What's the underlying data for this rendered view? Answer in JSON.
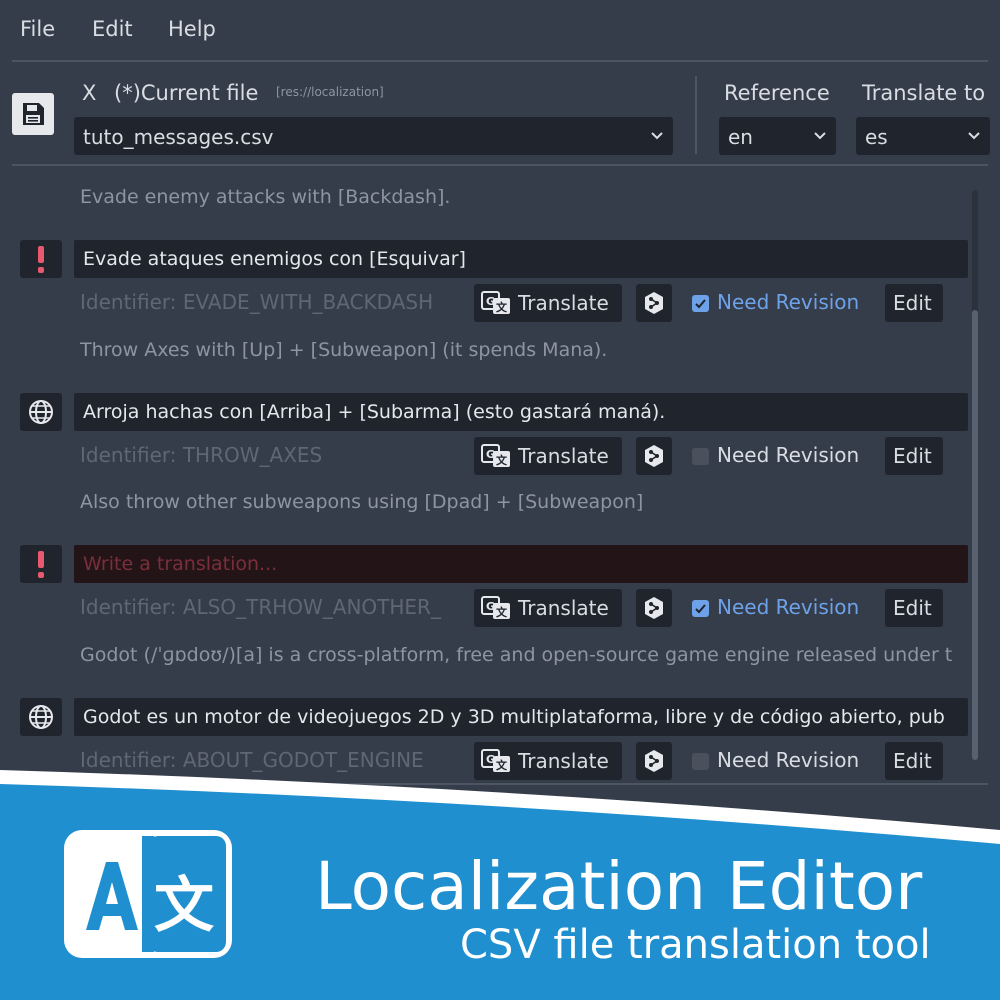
{
  "menu": {
    "file": "File",
    "edit": "Edit",
    "help": "Help"
  },
  "header": {
    "close_label": "X",
    "current_file_label": "(*)Current file",
    "path": "[res://localization]",
    "file_select": "tuto_messages.csv",
    "reference_label": "Reference",
    "reference_value": "en",
    "translate_to_label": "Translate to",
    "translate_to_value": "es"
  },
  "entries": [
    {
      "reference": "Evade enemy attacks with [Backdash].",
      "translation": "Evade ataques enemigos con [Esquivar]",
      "placeholder": "",
      "status": "warning",
      "identifier": "Identifier: EVADE_WITH_BACKDASH",
      "translate_label": "Translate",
      "need_revision_label": "Need Revision",
      "need_revision": true,
      "edit_label": "Edit"
    },
    {
      "reference": "Throw Axes with [Up] + [Subweapon] (it spends Mana).",
      "translation": "Arroja hachas con [Arriba] + [Subarma] (esto gastará maná).",
      "placeholder": "",
      "status": "translated",
      "identifier": "Identifier: THROW_AXES",
      "translate_label": "Translate",
      "need_revision_label": "Need Revision",
      "need_revision": false,
      "edit_label": "Edit"
    },
    {
      "reference": "Also throw other subweapons using [Dpad] + [Subweapon]",
      "translation": "",
      "placeholder": "Write a translation...",
      "status": "warning",
      "identifier": "Identifier: ALSO_TRHOW_ANOTHER_",
      "translate_label": "Translate",
      "need_revision_label": "Need Revision",
      "need_revision": true,
      "edit_label": "Edit"
    },
    {
      "reference": "Godot (/ˈɡɒdoʊ/)[a] is a cross-platform, free and open-source game engine released under t",
      "translation": "Godot es un motor de videojuegos 2D y 3D multiplataforma, libre y de código abierto, pub",
      "placeholder": "",
      "status": "translated",
      "identifier": "Identifier: ABOUT_GODOT_ENGINE",
      "translate_label": "Translate",
      "need_revision_label": "Need Revision",
      "need_revision": false,
      "edit_label": "Edit"
    }
  ],
  "banner": {
    "title": "Localization Editor",
    "subtitle": "CSV file translation tool",
    "logo_letters": "A 文"
  },
  "colors": {
    "background": "#363d4a",
    "field": "#1f242d",
    "warning": "#e8596e",
    "accent": "#6ea2e8",
    "banner": "#1f8fcf"
  },
  "icons": {
    "save": "save-icon",
    "warning": "exclamation-icon",
    "translated": "globe-icon",
    "translate": "google-translate-icon",
    "deepl": "deepl-icon",
    "dropdown": "chevron-down-icon"
  }
}
